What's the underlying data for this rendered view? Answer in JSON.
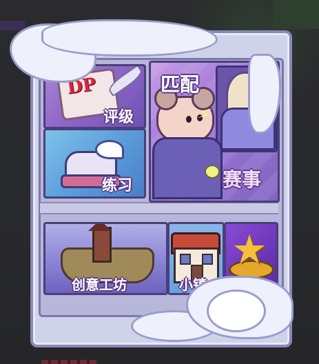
{
  "menu": {
    "rating_label": "评级",
    "rating_badge": "DP",
    "match_label": "匹配",
    "tournament_label": "赛事",
    "practice_label": "练习",
    "workshop_label": "创意工坊",
    "town_label": "小镇"
  },
  "colors": {
    "frame": "#cfd3ea",
    "frame_border": "#8b86b6",
    "label_outline": "#5a3a8a",
    "star": "#f6c13a"
  },
  "icons": {
    "rating": "scroll-quill-icon",
    "practice": "winged-shoe-icon",
    "match": "mouse-character-icon",
    "workshop": "floating-island-icon",
    "town": "house-icon",
    "special": "star-icon"
  }
}
